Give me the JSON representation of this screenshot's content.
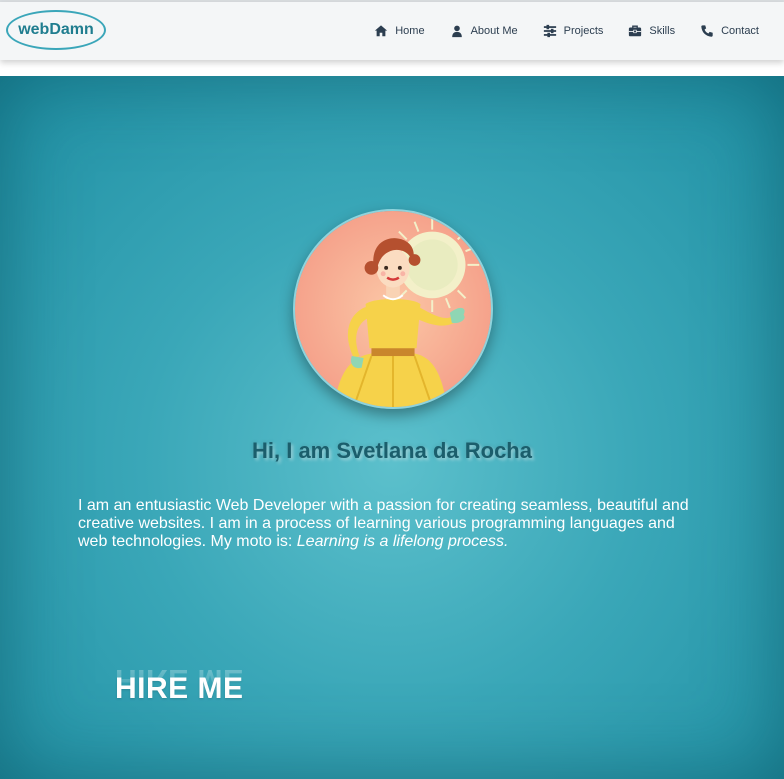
{
  "brand": {
    "logo_text": "webDamn"
  },
  "nav": {
    "items": [
      {
        "label": "Home",
        "icon": "home-icon"
      },
      {
        "label": "About Me",
        "icon": "user-icon"
      },
      {
        "label": "Projects",
        "icon": "projects-icon"
      },
      {
        "label": "Skills",
        "icon": "toolbox-icon"
      },
      {
        "label": "Contact",
        "icon": "phone-icon"
      }
    ]
  },
  "hero": {
    "title": "Hi, I am Svetlana da Rocha",
    "intro": "I am an entusiastic Web Developer with a passion for creating seamless, beautiful and creative websites. I am in a process of learning various programming languages and web technologies. My moto is: ",
    "motto": "Learning is a lifelong process.",
    "hire_label": "HIRE ME"
  },
  "colors": {
    "accent": "#3aa6b9",
    "hero_bg": "#3aa7b8",
    "title_text": "#1b5e6c",
    "nav_bg": "#f4f6f7"
  }
}
